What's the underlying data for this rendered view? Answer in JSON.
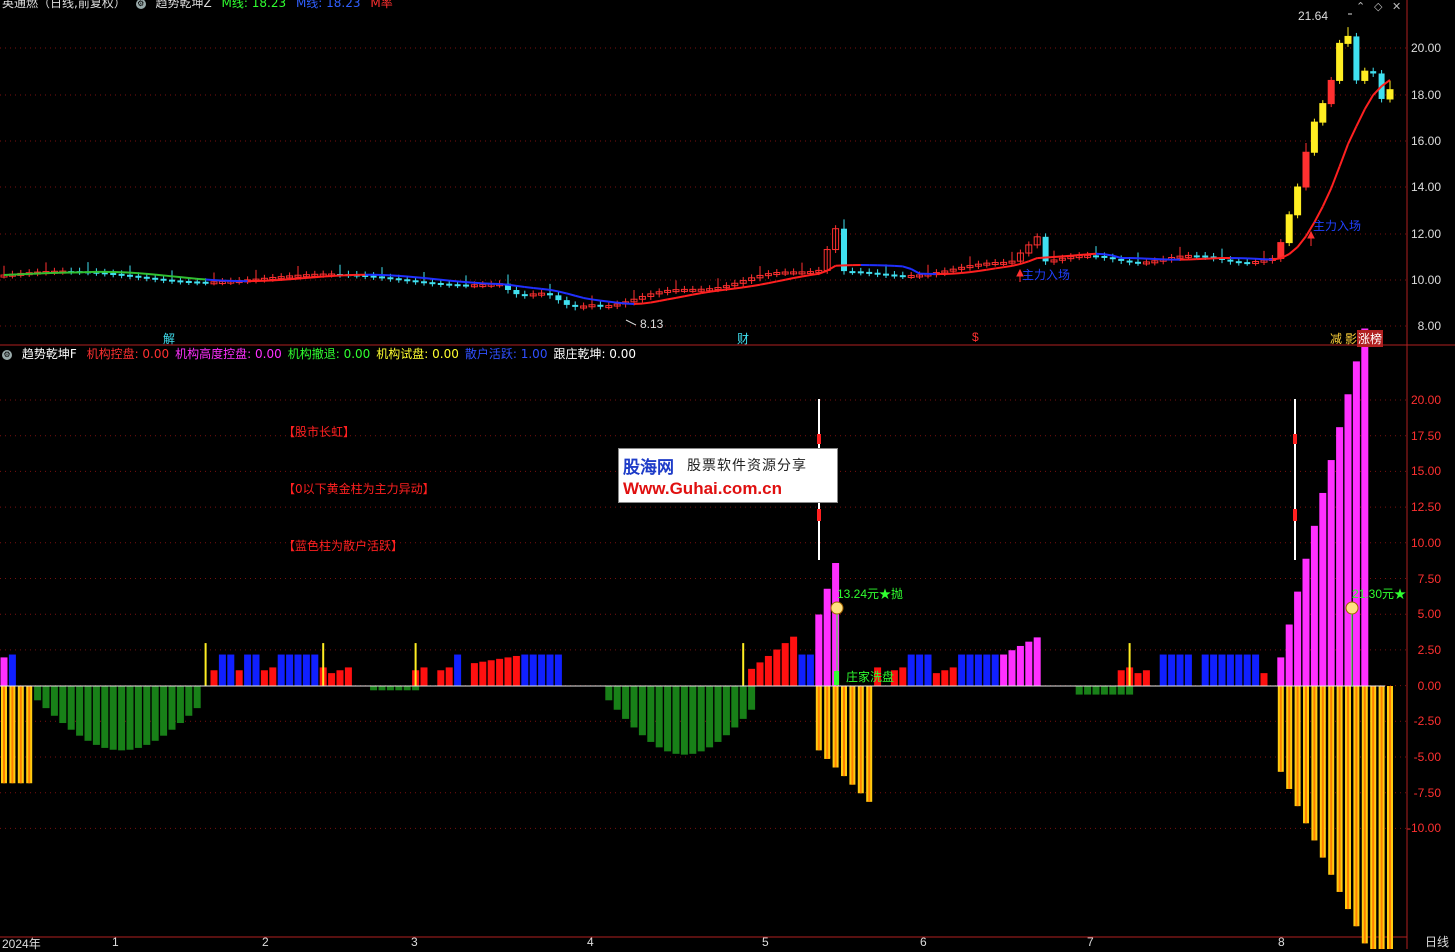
{
  "main_header": {
    "stock_title": "英通燃（日线,前复权）",
    "indicator_name": "趋势乾坤Z",
    "ma1_label": "M线: 18.23",
    "ma2_label": "M线: 18.23",
    "extra_label": "M率"
  },
  "sub_header": {
    "indicator_name": "趋势乾坤F",
    "items": [
      {
        "label": "机构控盘: 0.00",
        "color": "#ff3030"
      },
      {
        "label": "机构高度控盘: 0.00",
        "color": "#ff30ff"
      },
      {
        "label": "机构撤退: 0.00",
        "color": "#30ff30"
      },
      {
        "label": "机构试盘: 0.00",
        "color": "#ffff30"
      },
      {
        "label": "散户活跃: 1.00",
        "color": "#3050ff"
      },
      {
        "label": "跟庄乾坤: 0.00",
        "color": "#ffffff"
      }
    ]
  },
  "price_axis_labels": [
    "20.00",
    "18.00",
    "16.00",
    "14.00",
    "12.00",
    "10.00",
    "8.00"
  ],
  "indicator_axis_labels": [
    "20.00",
    "17.50",
    "15.00",
    "12.50",
    "10.00",
    "7.50",
    "5.00",
    "2.50",
    "0.00",
    "-2.50",
    "-5.00",
    "-7.50",
    "-10.00"
  ],
  "price_annotations": {
    "high": "21.64",
    "low": "8.13"
  },
  "signals": {
    "main_entry_1": "主力入场",
    "main_entry_2": "主力入场"
  },
  "bottom_markers": [
    "解",
    "财",
    "$",
    "减",
    "影",
    "涨榜"
  ],
  "notes": [
    "【股市长虹】",
    "【0以下黄金柱为主力异动】",
    "【蓝色柱为散户活跃】"
  ],
  "indicator_tags": {
    "sell1": "13.24元★抛",
    "sell2": "21.30元★",
    "wash": "庄家洗盘"
  },
  "watermark": {
    "line1": "股海网",
    "line1b": "股票软件资源分享",
    "line2": "Www.Guhai.com.cn"
  },
  "months": [
    "2024年",
    "1",
    "2",
    "3",
    "4",
    "5",
    "6",
    "7",
    "8"
  ],
  "period": "日线",
  "window_buttons": [
    "⌃",
    "◇",
    "✕"
  ],
  "colors": {
    "up": "#ff3030",
    "down": "#40e0f0",
    "ma": "#ff2020",
    "ma2": "#2030ff",
    "bg": "#000000",
    "grid": "#7a1010"
  }
}
